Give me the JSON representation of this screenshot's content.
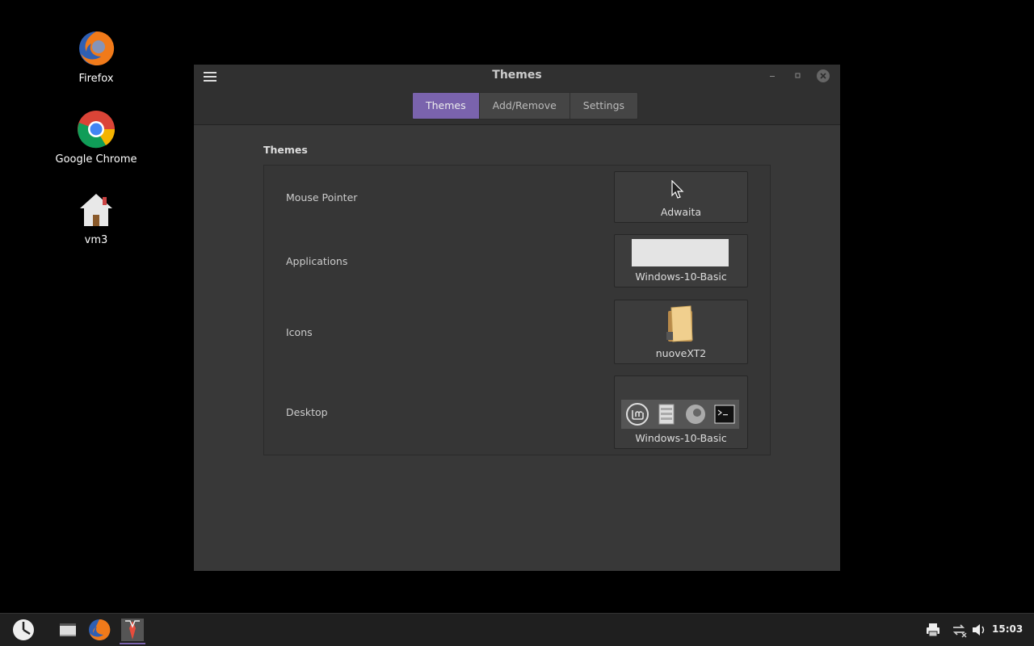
{
  "desktop": {
    "icons": [
      {
        "label": "Firefox"
      },
      {
        "label": "Google Chrome"
      },
      {
        "label": "vm3"
      }
    ]
  },
  "window": {
    "title": "Themes",
    "tabs": [
      {
        "label": "Themes",
        "active": true
      },
      {
        "label": "Add/Remove",
        "active": false
      },
      {
        "label": "Settings",
        "active": false
      }
    ],
    "section_title": "Themes",
    "rows": [
      {
        "label": "Mouse Pointer",
        "value": "Adwaita"
      },
      {
        "label": "Applications",
        "value": "Windows-10-Basic"
      },
      {
        "label": "Icons",
        "value": "nuoveXT2"
      },
      {
        "label": "Desktop",
        "value": "Windows-10-Basic"
      }
    ]
  },
  "taskbar": {
    "clock": "15:03"
  },
  "colors": {
    "accent": "#7a63ad",
    "window_bg": "#383838"
  }
}
